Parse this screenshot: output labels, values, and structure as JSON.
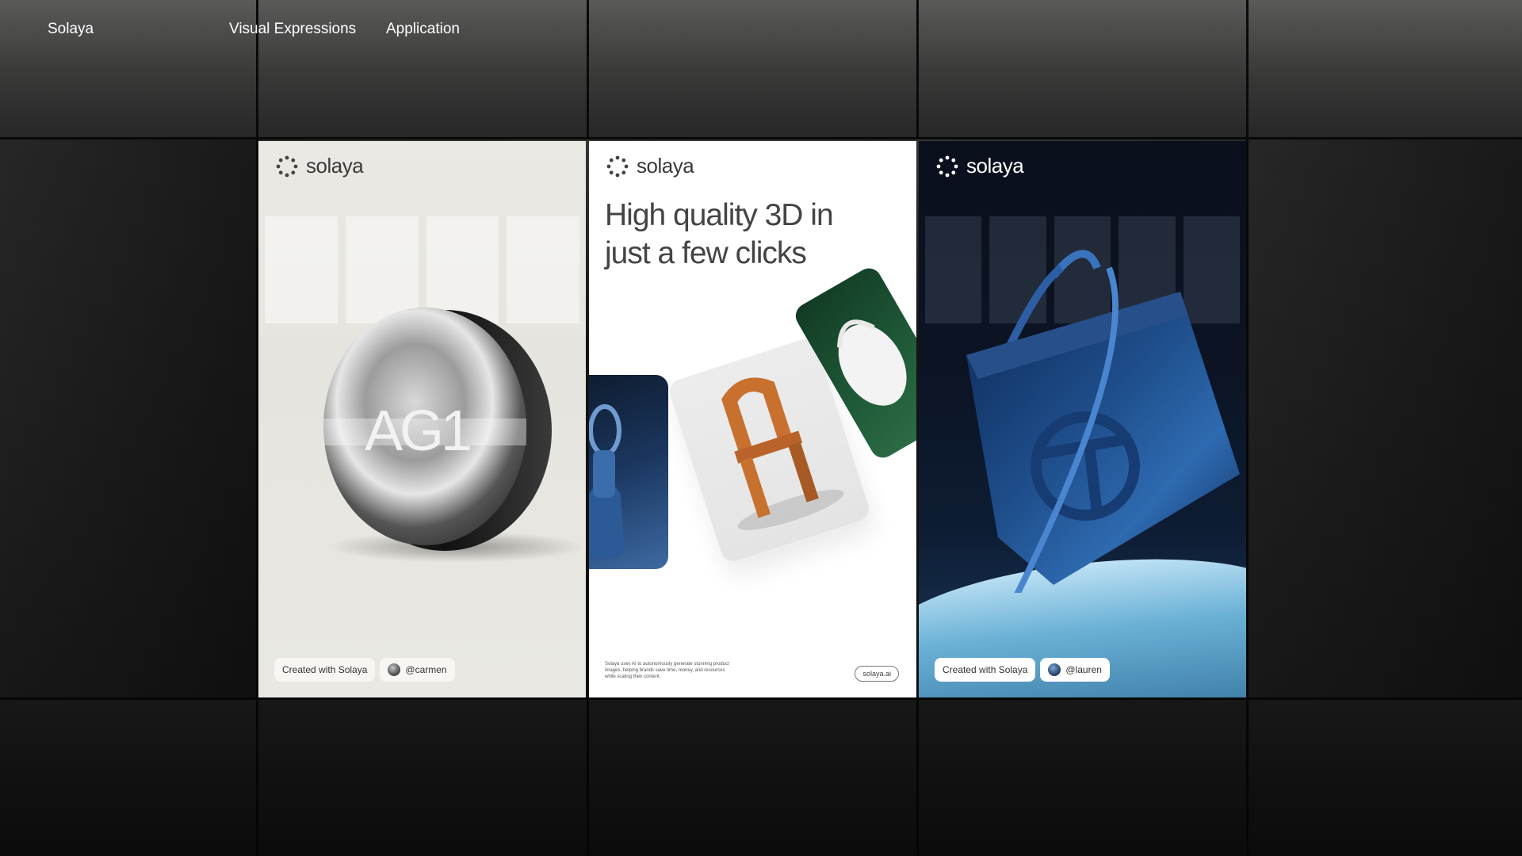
{
  "nav": {
    "brand": "Solaya",
    "links": [
      "Visual Expressions",
      "Application"
    ]
  },
  "cards": [
    {
      "logo": "solaya",
      "product_text": "AG1",
      "pills": {
        "created": "Created with Solaya",
        "user": "@carmen"
      }
    },
    {
      "logo": "solaya",
      "headline_line1": "High quality 3D in",
      "headline_line2": "just a few clicks",
      "fineprint": "Solaya uses AI to autonomously generate stunning product images, helping brands save time, money, and resources while scaling their content.",
      "url": "solaya.ai"
    },
    {
      "logo": "solaya",
      "pills": {
        "created": "Created with Solaya",
        "user": "@lauren"
      }
    }
  ],
  "colors": {
    "accent_blue": "#1f4f8c",
    "card_light": "#ebe9e4",
    "chair_orange": "#c8702e"
  }
}
